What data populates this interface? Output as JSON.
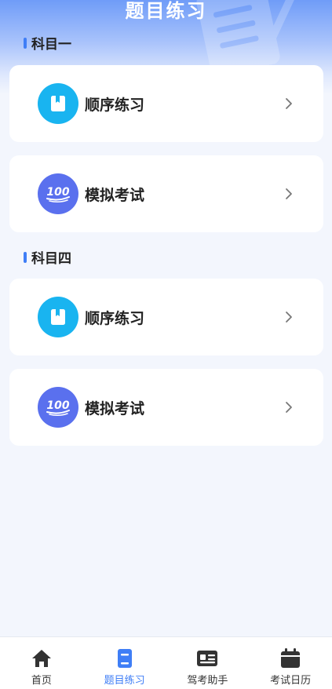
{
  "header": {
    "title": "题目练习"
  },
  "sections": [
    {
      "title": "科目一",
      "items": [
        {
          "label": "顺序练习",
          "icon": "book-icon"
        },
        {
          "label": "模拟考试",
          "icon": "score-100-icon",
          "badge": "100"
        }
      ]
    },
    {
      "title": "科目四",
      "items": [
        {
          "label": "顺序练习",
          "icon": "book-icon"
        },
        {
          "label": "模拟考试",
          "icon": "score-100-icon",
          "badge": "100"
        }
      ]
    }
  ],
  "tabbar": {
    "active": 1,
    "tabs": [
      {
        "label": "首页",
        "icon": "home-icon"
      },
      {
        "label": "题目练习",
        "icon": "book-icon"
      },
      {
        "label": "驾考助手",
        "icon": "id-card-icon"
      },
      {
        "label": "考试日历",
        "icon": "calendar-icon"
      }
    ]
  },
  "colors": {
    "accent": "#3f7ef6",
    "cyan_icon": "#19b4f0",
    "indigo_icon": "#5a70ee"
  }
}
